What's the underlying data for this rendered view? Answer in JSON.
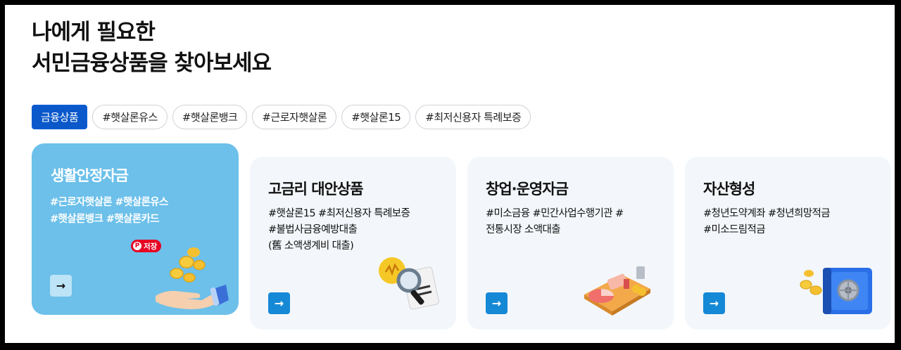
{
  "headline": {
    "line1": "나에게 필요한",
    "line2": "서민금융상품을 찾아보세요"
  },
  "chips": [
    {
      "label": "금융상품",
      "active": true
    },
    {
      "label": "#햇살론유스",
      "active": false
    },
    {
      "label": "#햇살론뱅크",
      "active": false
    },
    {
      "label": "#근로자햇살론",
      "active": false
    },
    {
      "label": "#햇살론15",
      "active": false
    },
    {
      "label": "#최저신용자 특례보증",
      "active": false
    }
  ],
  "cards": [
    {
      "title": "생활안정자금",
      "tags": [
        "#근로자햇살론 #햇살론유스",
        "#햇살론뱅크 #햇살론카드"
      ],
      "illustration": "hand-with-coins-icon"
    },
    {
      "title": "고금리 대안상품",
      "tags": [
        "#햇살론15 #최저신용자 특례보증",
        "#불법사금융예방대출",
        "(舊 소액생계비 대출)"
      ],
      "illustration": "magnifier-document-icon"
    },
    {
      "title": "창업·운영자금",
      "tags": [
        "#미소금융 #민간사업수행기관 #",
        "전통시장 소액대출"
      ],
      "illustration": "business-chart-icon"
    },
    {
      "title": "자산형성",
      "tags": [
        "#청년도약계좌 #청년희망적금",
        "#미소드림적금"
      ],
      "illustration": "safe-coins-icon"
    }
  ],
  "pinterest_save": {
    "label": "저장"
  },
  "colors": {
    "primary": "#0a58ca",
    "featured_card": "#6cc0ea",
    "card_bg": "#f3f7fb",
    "arrow_button": "#1689d6",
    "pinterest": "#e60023"
  }
}
